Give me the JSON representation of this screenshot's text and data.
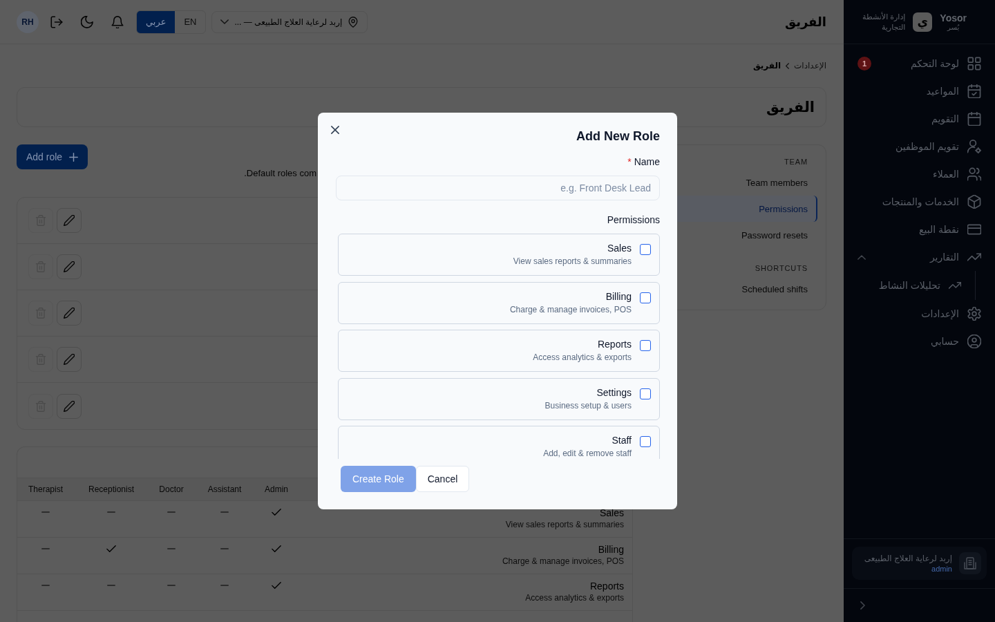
{
  "topbar": {
    "page_title": "الفريق",
    "user_initials": "RH",
    "languages": [
      {
        "label": "EN",
        "selected": false
      },
      {
        "label": "عربي",
        "selected": true
      }
    ],
    "location": {
      "value": "إربد لرعاية العلاج الطبيعى — ..."
    }
  },
  "breadcrumb": [
    {
      "label": "الإعدادات",
      "current": false
    },
    {
      "label": "الفريق",
      "current": true
    }
  ],
  "page": {
    "title": "الفريق"
  },
  "roles": {
    "add_button": "Add role",
    "description": ".Default roles com",
    "rows": [
      {
        "delete_disabled": true
      },
      {
        "delete_disabled": true
      },
      {
        "delete_disabled": true
      },
      {
        "delete_disabled": true
      },
      {
        "delete_disabled": true
      }
    ]
  },
  "permissions_table": {
    "columns": [
      "Admin",
      "Assistant",
      "Doctor",
      "Receptionist",
      "Therapist"
    ],
    "rows": [
      {
        "name": "Sales",
        "description": "View sales reports & summaries",
        "access": [
          true,
          false,
          false,
          false,
          false
        ]
      },
      {
        "name": "Billing",
        "description": "Charge & manage invoices, POS",
        "access": [
          true,
          false,
          false,
          true,
          false
        ]
      },
      {
        "name": "Reports",
        "description": "Access analytics & exports",
        "access": [
          true,
          false,
          false,
          false,
          false
        ]
      }
    ]
  },
  "subnav": {
    "sections": [
      {
        "heading": "TEAM",
        "items": [
          {
            "label": "Team members",
            "selected": false
          },
          {
            "label": "Permissions",
            "selected": true
          },
          {
            "label": "Password resets",
            "selected": false
          }
        ]
      },
      {
        "heading": "SHORTCUTS",
        "items": [
          {
            "label": "Scheduled shifts",
            "selected": false
          }
        ]
      }
    ]
  },
  "sidebar": {
    "brand": "Yosor",
    "brand_arabic": "يُسر",
    "logo_glyph": "ي",
    "tagline": [
      "إدارة الأنشطة",
      "التجارية"
    ],
    "items": [
      {
        "label": "لوحة التحكم",
        "badge": "1"
      },
      {
        "label": "المواعيد"
      },
      {
        "label": "التقويم"
      },
      {
        "label": "تقويم الموظفين"
      },
      {
        "label": "العملاء"
      },
      {
        "label": "الخدمات والمنتجات"
      },
      {
        "label": "نقطة البيع"
      },
      {
        "label": "التقارير",
        "expanded": true,
        "children": [
          {
            "label": "تحليلات النشاط"
          }
        ]
      },
      {
        "label": "الإعدادات"
      },
      {
        "label": "حسابي"
      }
    ],
    "business": {
      "name": "إربد لرعاية العلاج الطبيعى",
      "role": "admin"
    }
  },
  "dialog": {
    "title": "Add New Role",
    "name_field": {
      "label": "Name",
      "required_mark": "*",
      "placeholder": "e.g. Front Desk Lead"
    },
    "permissions_label": "Permissions",
    "permissions": [
      {
        "name": "Sales",
        "description": "View sales reports & summaries",
        "checked": false
      },
      {
        "name": "Billing",
        "description": "Charge & manage invoices, POS",
        "checked": false
      },
      {
        "name": "Reports",
        "description": "Access analytics & exports",
        "checked": false
      },
      {
        "name": "Settings",
        "description": "Business setup & users",
        "checked": false
      },
      {
        "name": "Staff",
        "description": "Add, edit & remove staff",
        "checked": false
      }
    ],
    "buttons": [
      {
        "label": "Cancel",
        "kind": "secondary",
        "disabled": false
      },
      {
        "label": "Create Role",
        "kind": "primary",
        "disabled": true
      }
    ]
  }
}
